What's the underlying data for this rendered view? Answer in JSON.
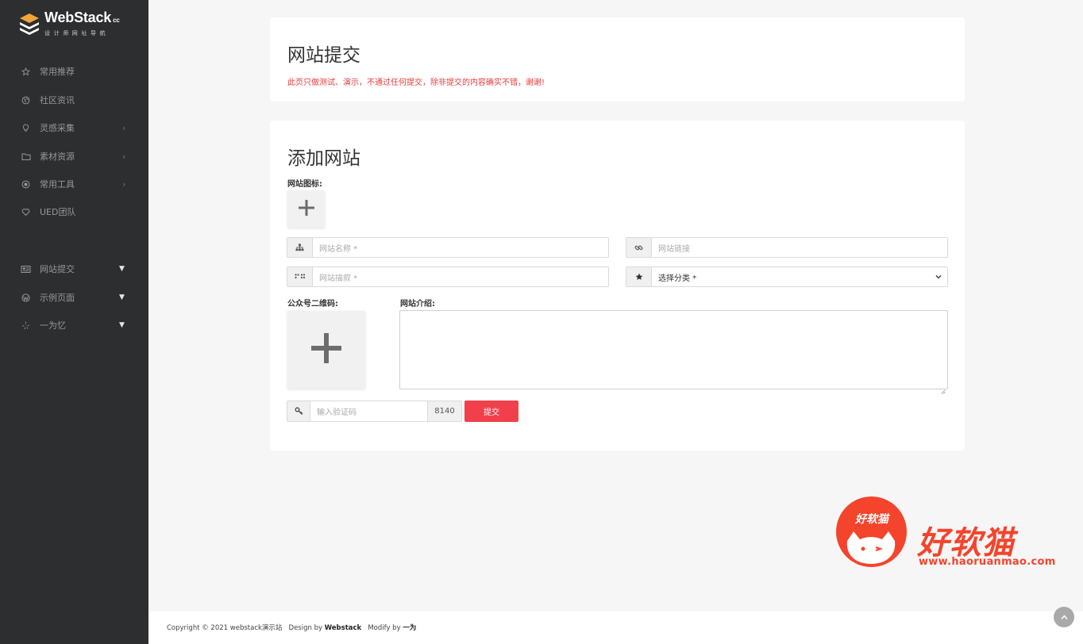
{
  "brand": {
    "name": "WebStack",
    "suffix": "cc",
    "tagline": "设计师网址导航"
  },
  "sidebar": {
    "items": [
      {
        "label": "常用推荐",
        "icon": "star-icon",
        "expand": "none"
      },
      {
        "label": "社区资讯",
        "icon": "globe-icon",
        "expand": "none"
      },
      {
        "label": "灵感采集",
        "icon": "lightbulb-icon",
        "expand": "chevron"
      },
      {
        "label": "素材资源",
        "icon": "folder-icon",
        "expand": "chevron"
      },
      {
        "label": "常用工具",
        "icon": "record-icon",
        "expand": "chevron"
      },
      {
        "label": "UED团队",
        "icon": "heart-icon",
        "expand": "none"
      }
    ],
    "extra_items": [
      {
        "label": "网站提交",
        "icon": "newspaper-icon",
        "expand": "triangle"
      },
      {
        "label": "示例页面",
        "icon": "wordpress-icon",
        "expand": "triangle"
      },
      {
        "label": "一为忆",
        "icon": "yelp-icon",
        "expand": "triangle"
      }
    ],
    "chevron": "›",
    "triangle": "▼"
  },
  "submit_header": {
    "title": "网站提交",
    "notice": "此页只做测试、演示，不通过任何提交，除非提交的内容确实不错，谢谢!"
  },
  "form": {
    "title": "添加网站",
    "icon_label": "网站图标:",
    "name_placeholder": "网站名称 *",
    "url_placeholder": "网站链接",
    "desc_placeholder": "网站描叙 *",
    "category_selected": "选择分类 *",
    "qr_label": "公众号二维码:",
    "intro_label": "网站介绍:",
    "captcha_placeholder": "输入验证码",
    "captcha_code": "8140",
    "submit_label": "提交"
  },
  "watermark": {
    "circle_text": "好软猫",
    "big_text": "好软猫",
    "url": "www.haoruanmao.com"
  },
  "footer": {
    "copyright": "Copyright © 2021 webstack演示站",
    "design_by": "Design by",
    "design_name": "Webstack",
    "modify_by": "Modify by",
    "modify_name": "一为"
  },
  "colors": {
    "sidebar_bg": "#2c2e2f",
    "accent": "#f1404b",
    "notice": "#e63b3b",
    "watermark": "#f4442c"
  }
}
